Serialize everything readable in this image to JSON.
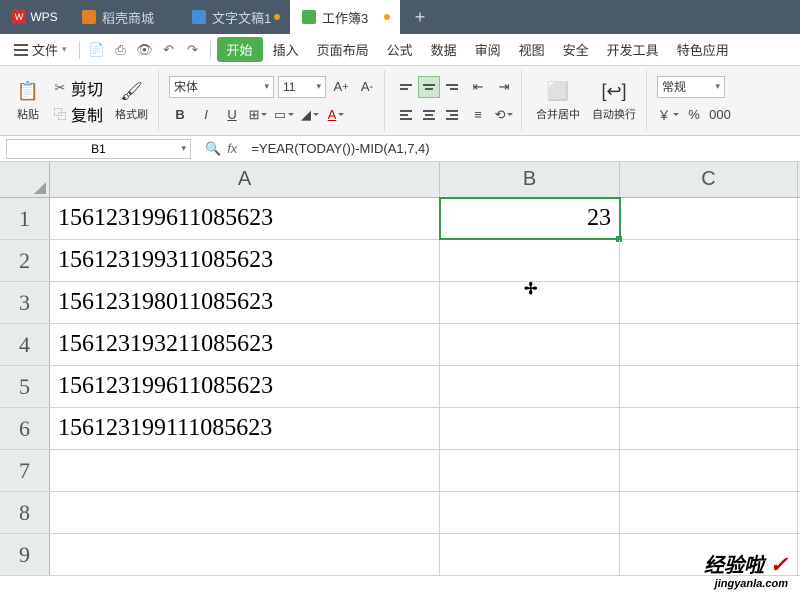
{
  "titlebar": {
    "app": "WPS",
    "tabs": [
      {
        "label": "稻壳商城",
        "icon": "shop"
      },
      {
        "label": "文字文稿1",
        "icon": "doc",
        "modified": true
      },
      {
        "label": "工作簿3",
        "icon": "sheet",
        "modified": true,
        "active": true
      }
    ],
    "new_tab": "+"
  },
  "menu": {
    "file": "文件",
    "items": [
      "开始",
      "插入",
      "页面布局",
      "公式",
      "数据",
      "审阅",
      "视图",
      "安全",
      "开发工具",
      "特色应用"
    ],
    "active": "开始"
  },
  "ribbon": {
    "paste": "粘贴",
    "cut": "剪切",
    "copy": "复制",
    "format_painter": "格式刷",
    "font_name": "宋体",
    "font_size": "11",
    "merge_center": "合并居中",
    "wrap_text": "自动换行",
    "number_format": "常规",
    "currency": "￥",
    "percent": "%",
    "thousand": "000"
  },
  "fxbar": {
    "cell_ref": "B1",
    "formula": "=YEAR(TODAY())-MID(A1,7,4)"
  },
  "grid": {
    "columns": [
      "A",
      "B",
      "C"
    ],
    "rows": [
      {
        "n": "1",
        "a": "156123199611085623",
        "b": "23"
      },
      {
        "n": "2",
        "a": "156123199311085623",
        "b": ""
      },
      {
        "n": "3",
        "a": "156123198011085623",
        "b": ""
      },
      {
        "n": "4",
        "a": "156123193211085623",
        "b": ""
      },
      {
        "n": "5",
        "a": "156123199611085623",
        "b": ""
      },
      {
        "n": "6",
        "a": "156123199111085623",
        "b": ""
      },
      {
        "n": "7",
        "a": "",
        "b": ""
      },
      {
        "n": "8",
        "a": "",
        "b": ""
      },
      {
        "n": "9",
        "a": "",
        "b": ""
      }
    ],
    "selected": "B1"
  },
  "watermark": {
    "line1": "经验啦",
    "line2": "jingyanla.com"
  }
}
